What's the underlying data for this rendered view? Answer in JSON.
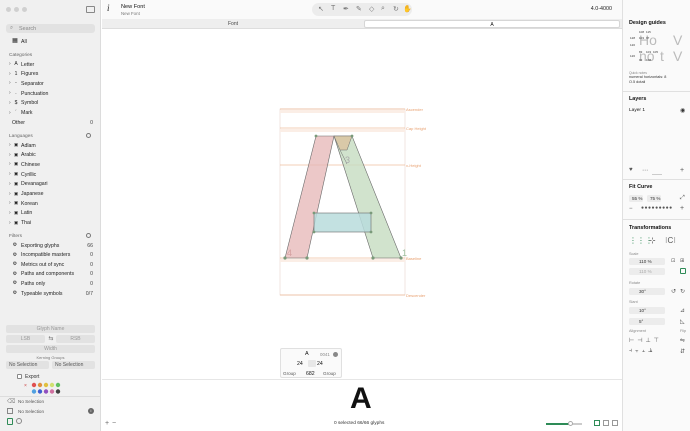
{
  "title": {
    "app": "New Font",
    "sub": "New Font",
    "version": "4.0-4000"
  },
  "sidebar": {
    "search_placeholder": "Search",
    "all_label": "All",
    "categories_title": "Categories",
    "categories": [
      {
        "label": "Letter",
        "icon": "A"
      },
      {
        "label": "Figures",
        "icon": "1"
      },
      {
        "label": "Separator",
        "icon": "-"
      },
      {
        "label": "Punctuation",
        "icon": "."
      },
      {
        "label": "Symbol",
        "icon": "$"
      },
      {
        "label": "Mark",
        "icon": "´"
      }
    ],
    "other_label": "Other",
    "other_count": "0",
    "languages_title": "Languages",
    "languages": [
      "Adlam",
      "Arabic",
      "Chinese",
      "Cyrillic",
      "Devanagari",
      "Japanese",
      "Korean",
      "Latin",
      "Thai"
    ],
    "filters_title": "Filters",
    "filters": [
      {
        "label": "Exporting glyphs",
        "count": "66"
      },
      {
        "label": "Incompatible masters",
        "count": "0"
      },
      {
        "label": "Metrics out of sync",
        "count": "0"
      },
      {
        "label": "Paths and components",
        "count": "0"
      },
      {
        "label": "Paths only",
        "count": "0"
      },
      {
        "label": "Typeable symbols",
        "count": "0/7"
      }
    ],
    "glyph_name": "Glyph Name",
    "lsb": "LSB",
    "rsb": "RSB",
    "width": "Width",
    "kerning_groups": "Kerning Groups",
    "no_selection": "No Selection",
    "export": "Export",
    "bottom_no_selection_1": "No Selection",
    "bottom_no_selection_2": "No Selection"
  },
  "tabs": [
    {
      "label": "Font"
    },
    {
      "label": "A"
    }
  ],
  "canvas": {
    "metrics": [
      "Ascender",
      "Cap Height",
      "x-Height",
      "Baseline",
      "Descender"
    ],
    "node_labels": [
      "3",
      "4",
      "1"
    ],
    "glyph_info": {
      "char": "A",
      "unicode": "0041",
      "lsb": "24",
      "rsb": "24",
      "width": "682",
      "left_group": "Group",
      "right_group": "Group"
    }
  },
  "bottom": {
    "preview_char": "A",
    "status": "0 selected 66/66 glyphs"
  },
  "right": {
    "design_guides": "Design guides",
    "guide_text_1": "Ho",
    "guide_text_2": "V",
    "guide_text_3": "no",
    "guide_text_4": "t",
    "guide_text_5": "V",
    "guide_nums": [
      "108",
      "115",
      "128",
      "103",
      "97",
      "120",
      "83",
      "103",
      "105",
      "126",
      "93",
      "108"
    ],
    "quick_notes_label": "Quick notes",
    "quick_notes_1": "numeral horizontals: 8",
    "quick_notes_2": "O.5 dotali",
    "layers": "Layers",
    "layer_1": "Layer 1",
    "fit_curve": "Fit Curve",
    "fit_1": "55 %",
    "fit_2": "75 %",
    "transformations": "Transformations",
    "scale_label": "Scale",
    "scale_x": "110 %",
    "scale_y": "110 %",
    "rotate_label": "Rotate",
    "rotate_val": "30°",
    "slant_label": "Slant",
    "slant_x": "10°",
    "slant_y": "5°",
    "align_label": "Alignment",
    "flip_label": "Flip"
  },
  "colors": {
    "accent": "#2e8b57",
    "metric_line": "#e8a070",
    "left_stem": "#e5b5b5",
    "right_stem": "#c5dcc0",
    "crossbar": "#b9dcdc"
  }
}
